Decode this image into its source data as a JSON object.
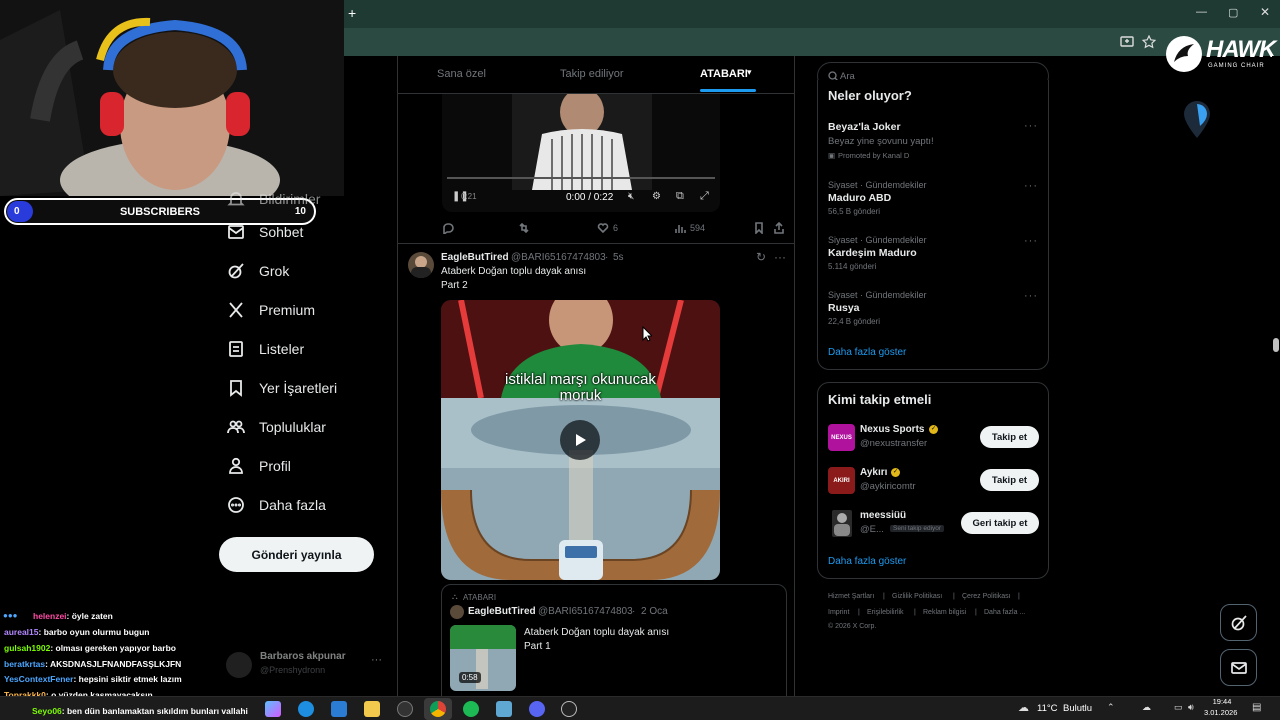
{
  "browser": {
    "new_tab": "+",
    "window_controls": [
      "—",
      "▢",
      "✕"
    ]
  },
  "overlay": {
    "subscribers_label": "SUBSCRIBERS",
    "subscribers_current": "0",
    "subscribers_goal": "10",
    "subscribers_progress": 0.0,
    "brand": "HAWK",
    "brand_sub": "GAMING CHAIR"
  },
  "sidebar": {
    "items": [
      {
        "label": "Bildirimler",
        "icon": "bell-icon"
      },
      {
        "label": "Sohbet",
        "icon": "chat-icon"
      },
      {
        "label": "Grok",
        "icon": "grok-icon"
      },
      {
        "label": "Premium",
        "icon": "x-logo-icon"
      },
      {
        "label": "Listeler",
        "icon": "list-icon"
      },
      {
        "label": "Yer İşaretleri",
        "icon": "bookmark-icon"
      },
      {
        "label": "Topluluklar",
        "icon": "communities-icon"
      },
      {
        "label": "Profil",
        "icon": "profile-icon"
      },
      {
        "label": "Daha fazla",
        "icon": "more-circle-icon"
      }
    ],
    "post_button": "Gönderi yayınla",
    "account": {
      "name": "Barbaros akpunar",
      "handle": "@Prenshydronn"
    }
  },
  "feed": {
    "tabs": [
      "Sana özel",
      "Takip ediliyor",
      "ATABARI"
    ],
    "active_tab": "ATABARI",
    "first_post": {
      "video_time": "0:00 / 0:22",
      "timer_left": "0:21",
      "likes": "6",
      "views": "594"
    },
    "second_post": {
      "author": "EagleButTired",
      "handle": "@BARI65167474803",
      "time": "5s",
      "text_line1": "Ataberk Doğan toplu dayak anısı",
      "text_line2": "Part 2",
      "video_caption_line1": "istiklal marşı okunucak",
      "video_caption_line2": "moruk"
    },
    "quote": {
      "community": "ATABARI",
      "author": "EagleButTired",
      "handle": "@BARI65167474803",
      "date": "2 Oca",
      "text_line1": "Ataberk Doğan toplu dayak anısı",
      "text_line2": "Part 1",
      "duration": "0:58"
    }
  },
  "right": {
    "search_placeholder": "Ara",
    "trends_title": "Neler oluyor?",
    "trends": [
      {
        "meta": "",
        "name": "Beyaz'la Joker",
        "sub": "Beyaz yine şovunu yaptı!",
        "promo": "Promoted by Kanal D"
      },
      {
        "meta": "Siyaset · Gündemdekiler",
        "name": "Maduro ABD",
        "sub": "56,5 B gönderi",
        "promo": ""
      },
      {
        "meta": "Siyaset · Gündemdekiler",
        "name": "Kardeşim Maduro",
        "sub": "5.114 gönderi",
        "promo": ""
      },
      {
        "meta": "Siyaset · Gündemdekiler",
        "name": "Rusya",
        "sub": "22,4 B gönderi",
        "promo": ""
      }
    ],
    "show_more": "Daha fazla göster",
    "who_to_follow_title": "Kimi takip etmeli",
    "follow": [
      {
        "name": "Nexus Sports",
        "handle": "@nexustransfer",
        "button": "Takip et",
        "badge": "",
        "avatar_color": "#b0119d"
      },
      {
        "name": "Aykırı",
        "handle": "@aykiricomtr",
        "button": "Takip et",
        "badge": "",
        "avatar_color": "#8b1a1a"
      },
      {
        "name": "meessiüü",
        "handle": "@E...",
        "button": "Geri takip et",
        "badge": "Seni takip ediyor",
        "avatar_color": "#444444"
      }
    ],
    "follow_show_more": "Daha fazla göster",
    "footer_row1": [
      "Hizmet Şartları",
      "Gizlilik Politikası",
      "Çerez Politikası"
    ],
    "footer_row2": [
      "Imprint",
      "Erişilebilirlik",
      "Reklam bilgisi",
      "Daha fazla ..."
    ],
    "copyright": "© 2026 X Corp."
  },
  "chat": [
    {
      "user": "helenzei",
      "msg": ": öyle zaten",
      "color": "#ff4da6"
    },
    {
      "user": "aureal15",
      "msg": ": barbo oyun olurmu bugun",
      "color": "#b388ff"
    },
    {
      "user": "gulsah1902",
      "msg": ": olması gereken yapıyor barbo",
      "color": "#7cfc00"
    },
    {
      "user": "beratkrtas",
      "msg": ": AKSDNASJLFNANDFASŞLKJFN",
      "color": "#4da6ff"
    },
    {
      "user": "YesContextFener",
      "msg": ": hepsini siktir etmek lazım",
      "color": "#4da6ff"
    },
    {
      "user": "Toprakkk0",
      "msg": ": o yüzden kasmayacaksın",
      "color": "#ffb84d"
    },
    {
      "user": "Seyo06",
      "msg": ": ben dün banlamaktan sıkıldım bunları vallahi",
      "color": "#7cfc00"
    }
  ],
  "taskbar": {
    "weather": "11°C",
    "weather_desc": "Bulutlu",
    "time": "19:44",
    "date": "3.01.2026"
  }
}
